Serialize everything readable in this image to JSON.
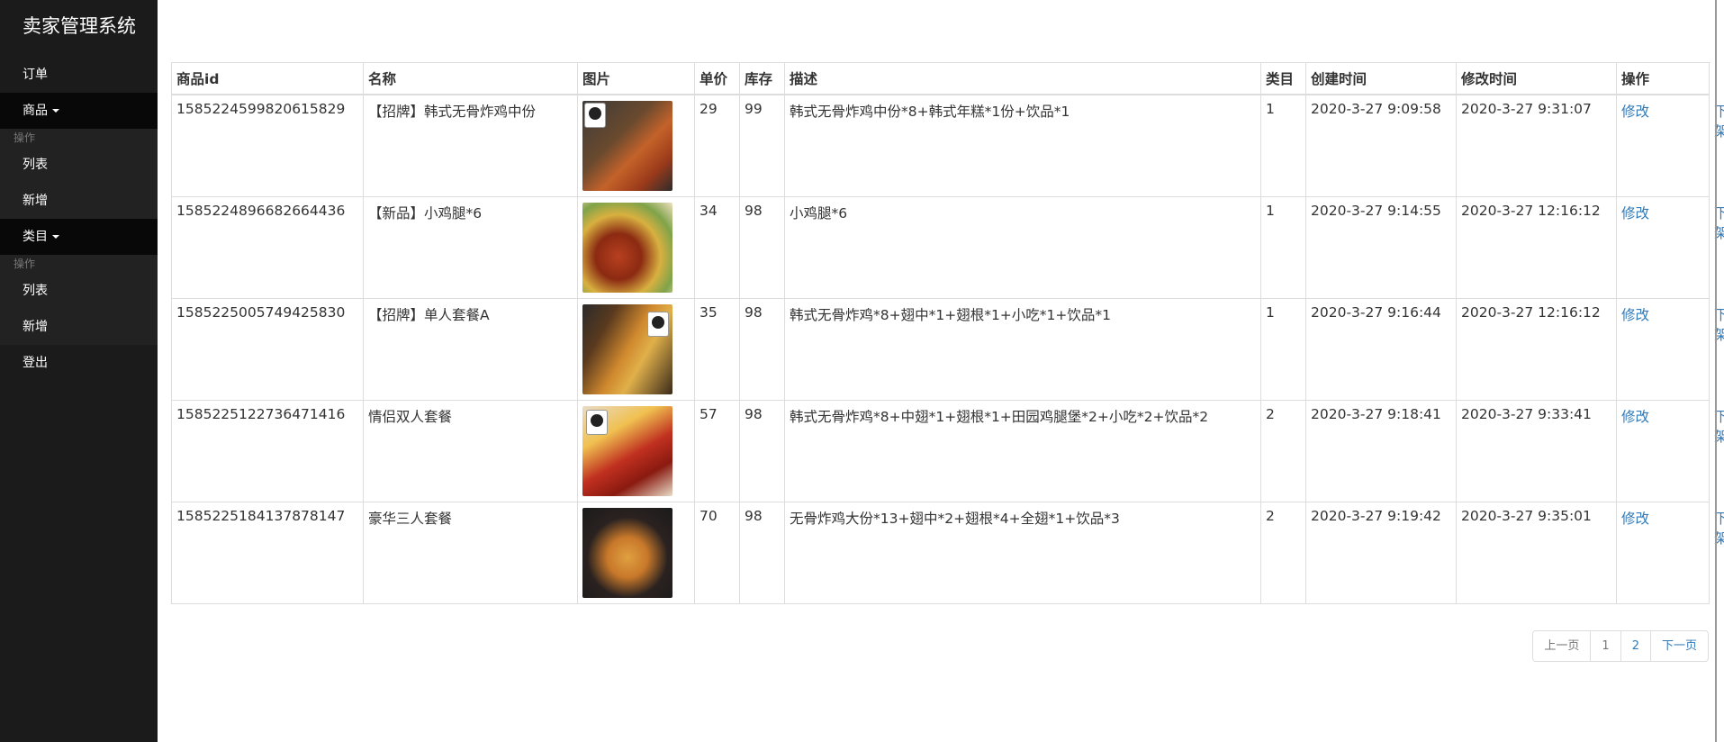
{
  "sidebar": {
    "brand": "卖家管理系统",
    "orders": "订单",
    "products": "商品",
    "products_header": "操作",
    "products_list": "列表",
    "products_new": "新增",
    "categories": "类目",
    "categories_header": "操作",
    "categories_list": "列表",
    "categories_new": "新增",
    "logout": "登出"
  },
  "table": {
    "headers": [
      "商品id",
      "名称",
      "图片",
      "单价",
      "库存",
      "描述",
      "类目",
      "创建时间",
      "修改时间",
      "操作"
    ],
    "edit_label": "修改",
    "offshelf_label": "下架",
    "rows": [
      {
        "id": "1585224599820615829",
        "name": "【招牌】韩式无骨炸鸡中份",
        "price": "29",
        "stock": "99",
        "desc": "韩式无骨炸鸡中份*8+韩式年糕*1份+饮品*1",
        "category": "1",
        "created": "2020-3-27 9:09:58",
        "updated": "2020-3-27 9:31:07"
      },
      {
        "id": "1585224896682664436",
        "name": "【新品】小鸡腿*6",
        "price": "34",
        "stock": "98",
        "desc": "小鸡腿*6",
        "category": "1",
        "created": "2020-3-27 9:14:55",
        "updated": "2020-3-27 12:16:12"
      },
      {
        "id": "1585225005749425830",
        "name": "【招牌】单人套餐A",
        "price": "35",
        "stock": "98",
        "desc": "韩式无骨炸鸡*8+翅中*1+翅根*1+小吃*1+饮品*1",
        "category": "1",
        "created": "2020-3-27 9:16:44",
        "updated": "2020-3-27 12:16:12"
      },
      {
        "id": "1585225122736471416",
        "name": "情侣双人套餐",
        "price": "57",
        "stock": "98",
        "desc": "韩式无骨炸鸡*8+中翅*1+翅根*1+田园鸡腿堡*2+小吃*2+饮品*2",
        "category": "2",
        "created": "2020-3-27 9:18:41",
        "updated": "2020-3-27 9:33:41"
      },
      {
        "id": "1585225184137878147",
        "name": "豪华三人套餐",
        "price": "70",
        "stock": "98",
        "desc": "无骨炸鸡大份*13+翅中*2+翅根*4+全翅*1+饮品*3",
        "category": "2",
        "created": "2020-3-27 9:19:42",
        "updated": "2020-3-27 9:35:01"
      }
    ]
  },
  "pagination": {
    "prev": "上一页",
    "page1": "1",
    "page2": "2",
    "next": "下一页"
  }
}
